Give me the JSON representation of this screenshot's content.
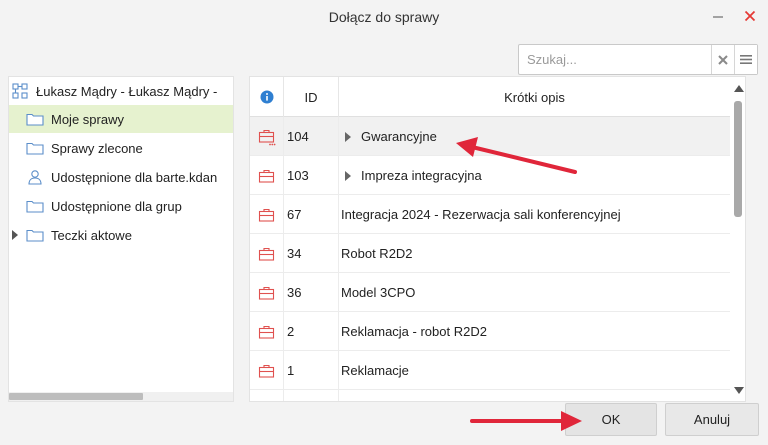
{
  "window": {
    "title": "Dołącz do sprawy",
    "minimize_icon": "minimize-icon",
    "close_icon": "close-icon",
    "accent_color": "#e53935"
  },
  "search": {
    "placeholder": "Szukaj...",
    "value": "",
    "clear_icon": "clear-x-icon",
    "menu_icon": "hamburger-menu-icon"
  },
  "tree": {
    "items": [
      {
        "label": "Łukasz Mądry - Łukasz Mądry -",
        "icon": "hierarchy-icon",
        "selected": false,
        "expandable": false
      },
      {
        "label": "Moje sprawy",
        "icon": "folder-icon",
        "selected": true,
        "expandable": false
      },
      {
        "label": "Sprawy zlecone",
        "icon": "folder-icon",
        "selected": false,
        "expandable": false
      },
      {
        "label": "Udostępnione dla barte.kdan",
        "icon": "user-icon",
        "selected": false,
        "expandable": false
      },
      {
        "label": "Udostępnione dla grup",
        "icon": "folder-icon",
        "selected": false,
        "expandable": false
      },
      {
        "label": "Teczki aktowe",
        "icon": "folder-icon",
        "selected": false,
        "expandable": true
      }
    ]
  },
  "grid": {
    "columns": {
      "info_icon": "info-icon",
      "id": "ID",
      "description": "Krótki opis"
    },
    "rows": [
      {
        "id": "104",
        "description": "Gwarancyjne",
        "expandable": true,
        "selected": true,
        "icon": "briefcase-icon"
      },
      {
        "id": "103",
        "description": "Impreza integracyjna",
        "expandable": true,
        "selected": false,
        "icon": "briefcase-icon"
      },
      {
        "id": "67",
        "description": "Integracja 2024 - Rezerwacja sali konferencyjnej",
        "expandable": false,
        "selected": false,
        "icon": "briefcase-icon"
      },
      {
        "id": "34",
        "description": "Robot R2D2",
        "expandable": false,
        "selected": false,
        "icon": "briefcase-icon"
      },
      {
        "id": "36",
        "description": "Model 3CPO",
        "expandable": false,
        "selected": false,
        "icon": "briefcase-icon"
      },
      {
        "id": "2",
        "description": "Reklamacja - robot R2D2",
        "expandable": false,
        "selected": false,
        "icon": "briefcase-icon"
      },
      {
        "id": "1",
        "description": "Reklamacje",
        "expandable": false,
        "selected": false,
        "icon": "briefcase-icon"
      }
    ]
  },
  "buttons": {
    "ok": "OK",
    "cancel": "Anuluj"
  },
  "annotations": {
    "arrow_color": "#e0263a"
  }
}
